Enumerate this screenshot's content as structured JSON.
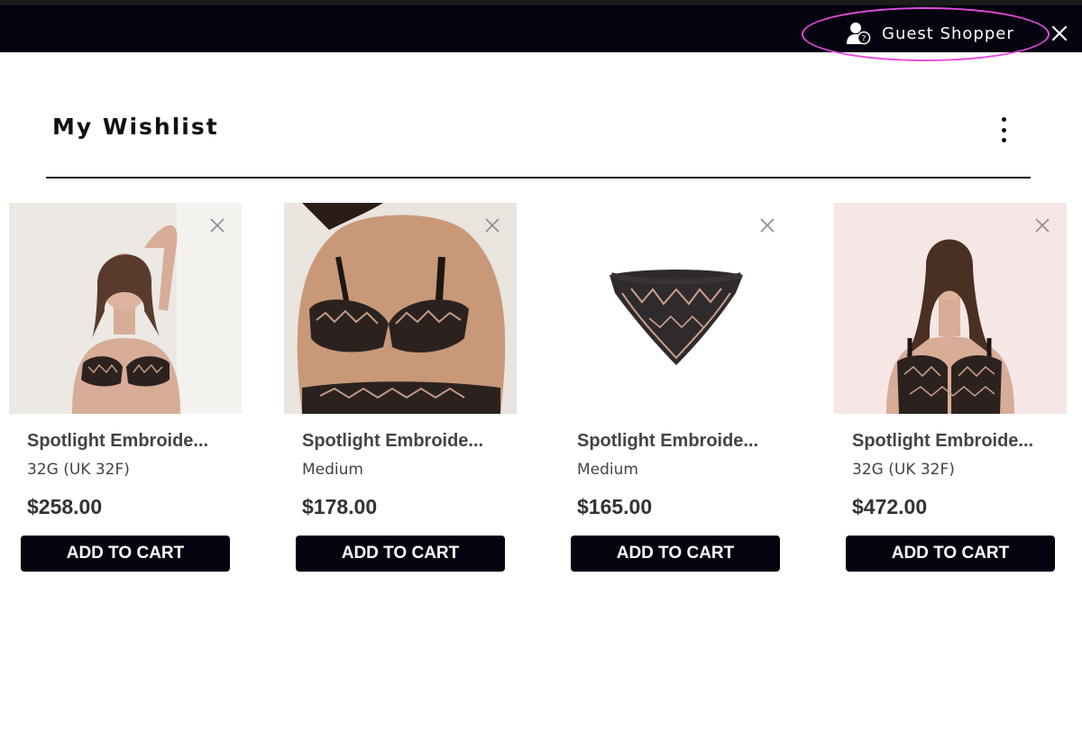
{
  "header": {
    "user_label": "Guest Shopper",
    "user_icon": "guest-user-icon",
    "close_icon": "close-icon",
    "highlight_color": "#e64ce0"
  },
  "wishlist": {
    "title": "My Wishlist",
    "menu_icon": "kebab-menu-icon",
    "items": [
      {
        "name": "Spotlight Embroide...",
        "size": "32G (UK 32F)",
        "price": "$258.00",
        "button": "ADD TO CART"
      },
      {
        "name": "Spotlight Embroide...",
        "size": "Medium",
        "price": "$178.00",
        "button": "ADD TO CART"
      },
      {
        "name": "Spotlight Embroide...",
        "size": "Medium",
        "price": "$165.00",
        "button": "ADD TO CART"
      },
      {
        "name": "Spotlight Embroide...",
        "size": "32G (UK 32F)",
        "price": "$472.00",
        "button": "ADD TO CART"
      }
    ]
  },
  "colors": {
    "topbar": "#05030f",
    "button": "#05030f",
    "text": "#444444"
  }
}
